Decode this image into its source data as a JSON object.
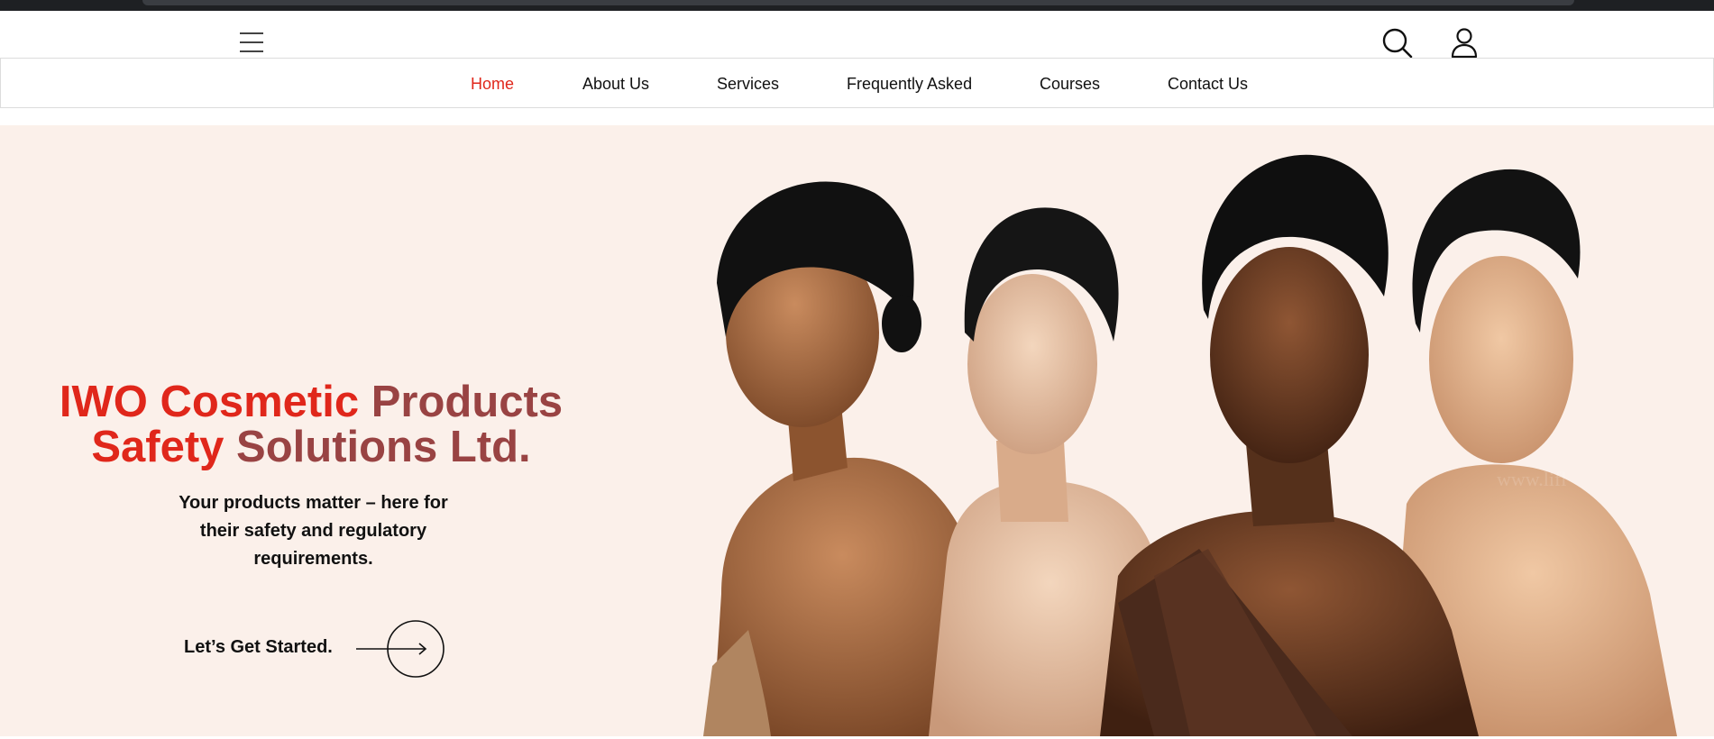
{
  "header": {
    "menu_icon": "hamburger-menu-icon",
    "search_icon": "search-icon",
    "account_icon": "user-account-icon"
  },
  "nav": {
    "items": [
      {
        "label": "Home",
        "active": true
      },
      {
        "label": "About Us"
      },
      {
        "label": "Services"
      },
      {
        "label": "Frequently Asked"
      },
      {
        "label": "Courses"
      },
      {
        "label": "Contact Us"
      }
    ],
    "active_color": "#e0271b"
  },
  "hero": {
    "title_line1_red": "IWO Cosmetic",
    "title_line1_dark": "Products",
    "title_line2_red": "Safety",
    "title_line2_dark": "Solutions Ltd.",
    "subtitle": "Your products matter – here for their safety and regulatory requirements.",
    "cta_label": "Let’s Get Started.",
    "cta_icon": "arrow-right-circle-icon",
    "background_color": "#fbf0ea",
    "image_description_icon": "models-photo"
  },
  "colors": {
    "brand_red": "#e0271b",
    "brand_dark_red": "#994343"
  }
}
